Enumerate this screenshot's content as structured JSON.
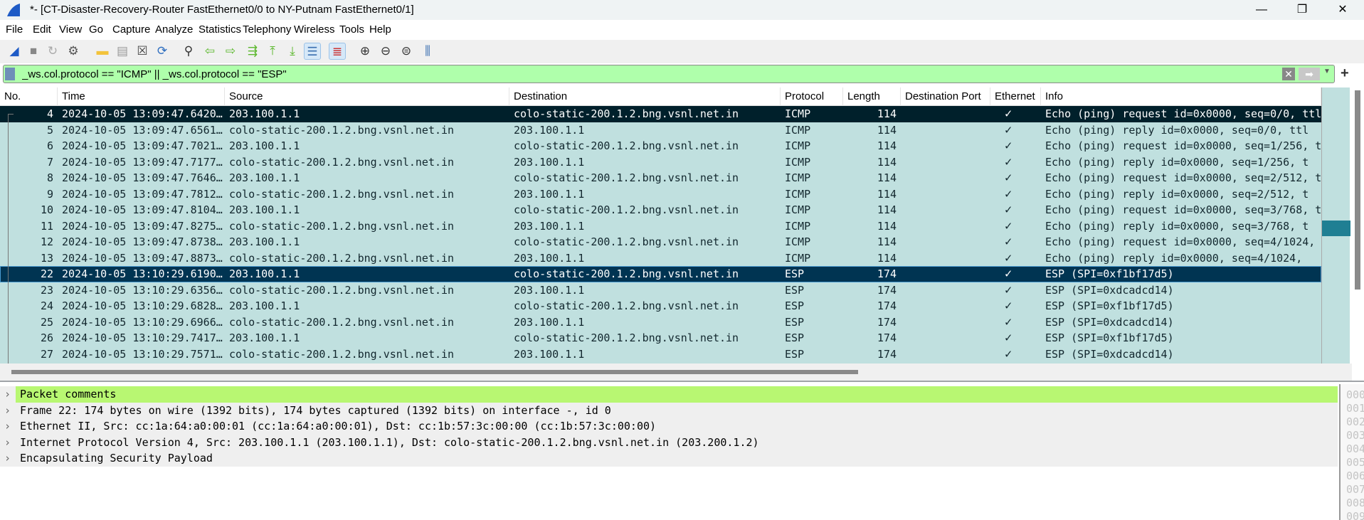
{
  "window": {
    "title": "*- [CT-Disaster-Recovery-Router FastEthernet0/0 to NY-Putnam FastEthernet0/1]",
    "minimize": "—",
    "restore": "❐",
    "close": "✕"
  },
  "menu": [
    "File",
    "Edit",
    "View",
    "Go",
    "Capture",
    "Analyze",
    "Statistics",
    "Telephony",
    "Wireless",
    "Tools",
    "Help"
  ],
  "toolbar": [
    "shark-fin-icon",
    "stop-icon",
    "restart-icon",
    "options-gear-icon",
    "open-folder-icon",
    "file-icon",
    "close-file-icon",
    "reload-icon",
    "find-icon",
    "back-arrow-icon",
    "forward-arrow-icon",
    "go-to-packet-icon",
    "first-packet-icon",
    "last-packet-icon",
    "autoscroll-icon",
    "colorize-icon",
    "zoom-in-icon",
    "zoom-out-icon",
    "zoom-normal-icon",
    "resize-columns-icon"
  ],
  "filter": {
    "value": "_ws.col.protocol == \"ICMP\" || _ws.col.protocol == \"ESP\"",
    "bg": "#afffab"
  },
  "columns": [
    "No.",
    "Time",
    "Source",
    "Destination",
    "Protocol",
    "Length",
    "Destination Port",
    "Ethernet",
    "Info"
  ],
  "packets": [
    {
      "no": "4",
      "time": "2024-10-05 13:09:47.6420…",
      "src": "203.100.1.1",
      "dst": "colo-static-200.1.2.bng.vsnl.net.in",
      "proto": "ICMP",
      "len": "114",
      "dport": "",
      "eth": "✓",
      "info": "Echo (ping) request  id=0x0000, seq=0/0, ttl"
    },
    {
      "no": "5",
      "time": "2024-10-05 13:09:47.6561…",
      "src": "colo-static-200.1.2.bng.vsnl.net.in",
      "dst": "203.100.1.1",
      "proto": "ICMP",
      "len": "114",
      "dport": "",
      "eth": "✓",
      "info": "Echo (ping) reply    id=0x0000, seq=0/0, ttl"
    },
    {
      "no": "6",
      "time": "2024-10-05 13:09:47.7021…",
      "src": "203.100.1.1",
      "dst": "colo-static-200.1.2.bng.vsnl.net.in",
      "proto": "ICMP",
      "len": "114",
      "dport": "",
      "eth": "✓",
      "info": "Echo (ping) request  id=0x0000, seq=1/256, t"
    },
    {
      "no": "7",
      "time": "2024-10-05 13:09:47.7177…",
      "src": "colo-static-200.1.2.bng.vsnl.net.in",
      "dst": "203.100.1.1",
      "proto": "ICMP",
      "len": "114",
      "dport": "",
      "eth": "✓",
      "info": "Echo (ping) reply    id=0x0000, seq=1/256, t"
    },
    {
      "no": "8",
      "time": "2024-10-05 13:09:47.7646…",
      "src": "203.100.1.1",
      "dst": "colo-static-200.1.2.bng.vsnl.net.in",
      "proto": "ICMP",
      "len": "114",
      "dport": "",
      "eth": "✓",
      "info": "Echo (ping) request  id=0x0000, seq=2/512, t"
    },
    {
      "no": "9",
      "time": "2024-10-05 13:09:47.7812…",
      "src": "colo-static-200.1.2.bng.vsnl.net.in",
      "dst": "203.100.1.1",
      "proto": "ICMP",
      "len": "114",
      "dport": "",
      "eth": "✓",
      "info": "Echo (ping) reply    id=0x0000, seq=2/512, t"
    },
    {
      "no": "10",
      "time": "2024-10-05 13:09:47.8104…",
      "src": "203.100.1.1",
      "dst": "colo-static-200.1.2.bng.vsnl.net.in",
      "proto": "ICMP",
      "len": "114",
      "dport": "",
      "eth": "✓",
      "info": "Echo (ping) request  id=0x0000, seq=3/768, t"
    },
    {
      "no": "11",
      "time": "2024-10-05 13:09:47.8275…",
      "src": "colo-static-200.1.2.bng.vsnl.net.in",
      "dst": "203.100.1.1",
      "proto": "ICMP",
      "len": "114",
      "dport": "",
      "eth": "✓",
      "info": "Echo (ping) reply    id=0x0000, seq=3/768, t"
    },
    {
      "no": "12",
      "time": "2024-10-05 13:09:47.8738…",
      "src": "203.100.1.1",
      "dst": "colo-static-200.1.2.bng.vsnl.net.in",
      "proto": "ICMP",
      "len": "114",
      "dport": "",
      "eth": "✓",
      "info": "Echo (ping) request  id=0x0000, seq=4/1024,"
    },
    {
      "no": "13",
      "time": "2024-10-05 13:09:47.8873…",
      "src": "colo-static-200.1.2.bng.vsnl.net.in",
      "dst": "203.100.1.1",
      "proto": "ICMP",
      "len": "114",
      "dport": "",
      "eth": "✓",
      "info": "Echo (ping) reply    id=0x0000, seq=4/1024,"
    },
    {
      "no": "22",
      "time": "2024-10-05 13:10:29.6190…",
      "src": "203.100.1.1",
      "dst": "colo-static-200.1.2.bng.vsnl.net.in",
      "proto": "ESP",
      "len": "174",
      "dport": "",
      "eth": "✓",
      "info": "ESP (SPI=0xf1bf17d5)"
    },
    {
      "no": "23",
      "time": "2024-10-05 13:10:29.6356…",
      "src": "colo-static-200.1.2.bng.vsnl.net.in",
      "dst": "203.100.1.1",
      "proto": "ESP",
      "len": "174",
      "dport": "",
      "eth": "✓",
      "info": "ESP (SPI=0xdcadcd14)"
    },
    {
      "no": "24",
      "time": "2024-10-05 13:10:29.6828…",
      "src": "203.100.1.1",
      "dst": "colo-static-200.1.2.bng.vsnl.net.in",
      "proto": "ESP",
      "len": "174",
      "dport": "",
      "eth": "✓",
      "info": "ESP (SPI=0xf1bf17d5)"
    },
    {
      "no": "25",
      "time": "2024-10-05 13:10:29.6966…",
      "src": "colo-static-200.1.2.bng.vsnl.net.in",
      "dst": "203.100.1.1",
      "proto": "ESP",
      "len": "174",
      "dport": "",
      "eth": "✓",
      "info": "ESP (SPI=0xdcadcd14)"
    },
    {
      "no": "26",
      "time": "2024-10-05 13:10:29.7417…",
      "src": "203.100.1.1",
      "dst": "colo-static-200.1.2.bng.vsnl.net.in",
      "proto": "ESP",
      "len": "174",
      "dport": "",
      "eth": "✓",
      "info": "ESP (SPI=0xf1bf17d5)"
    },
    {
      "no": "27",
      "time": "2024-10-05 13:10:29.7571…",
      "src": "colo-static-200.1.2.bng.vsnl.net.in",
      "dst": "203.100.1.1",
      "proto": "ESP",
      "len": "174",
      "dport": "",
      "eth": "✓",
      "info": "ESP (SPI=0xdcadcd14)"
    }
  ],
  "selected_packet": "22",
  "colors": {
    "row_bg": "#c0e0df",
    "selected_bg": "#003452",
    "comment_bg": "#b8f772"
  },
  "details": [
    "Packet comments",
    "Frame 22: 174 bytes on wire (1392 bits), 174 bytes captured (1392 bits) on interface -, id 0",
    "Ethernet II, Src: cc:1a:64:a0:00:01 (cc:1a:64:a0:00:01), Dst: cc:1b:57:3c:00:00 (cc:1b:57:3c:00:00)",
    "Internet Protocol Version 4, Src: 203.100.1.1 (203.100.1.1), Dst: colo-static-200.1.2.bng.vsnl.net.in (203.200.1.2)",
    "Encapsulating Security Payload"
  ],
  "hex_offsets": [
    "000",
    "001",
    "002",
    "003",
    "004",
    "005",
    "006",
    "007",
    "008",
    "009"
  ]
}
